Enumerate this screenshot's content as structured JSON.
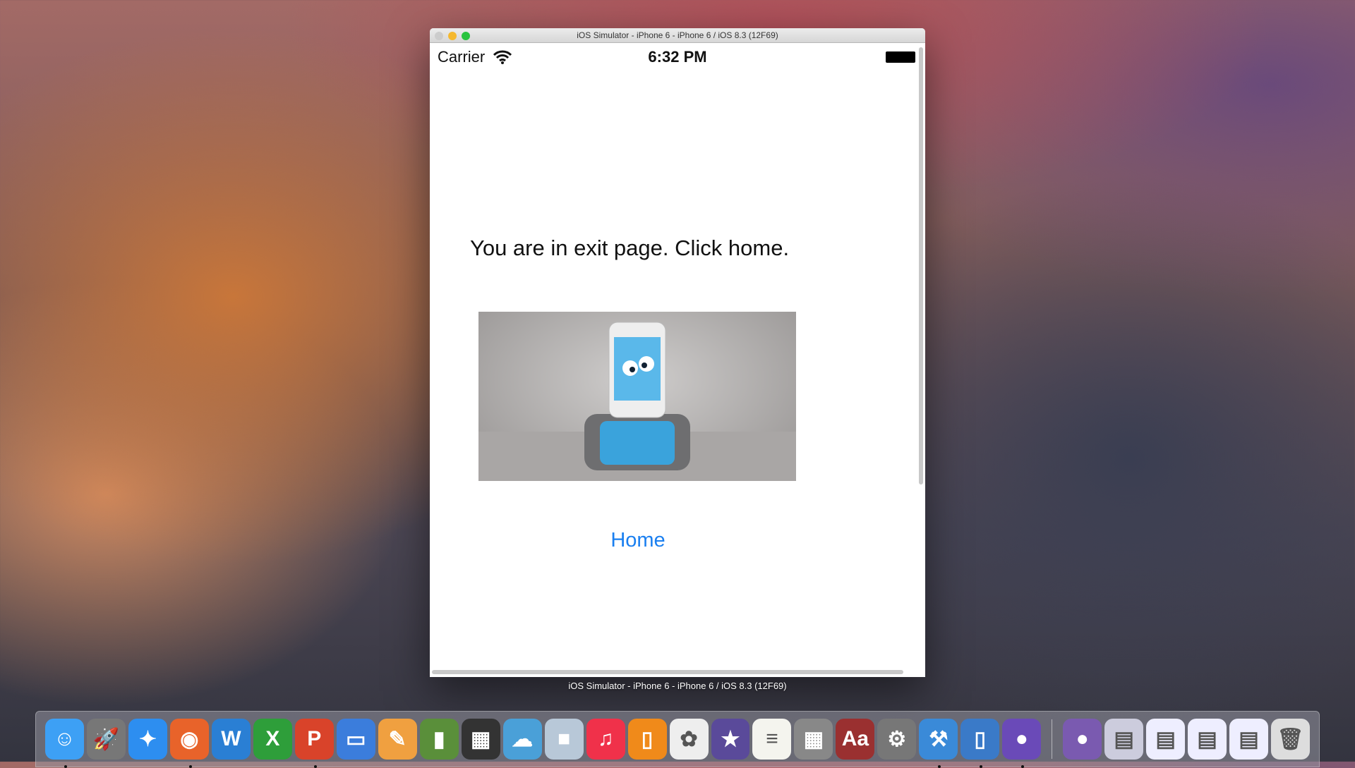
{
  "window": {
    "title": "iOS Simulator - iPhone 6 - iPhone 6 / iOS 8.3 (12F69)",
    "caption": "iOS Simulator - iPhone 6 - iPhone 6 / iOS 8.3 (12F69)"
  },
  "status_bar": {
    "carrier": "Carrier",
    "time": "6:32 PM"
  },
  "screen": {
    "message": "You are in exit page. Click home.",
    "home_link": "Home"
  },
  "dock": {
    "apps": [
      "Finder",
      "Launchpad",
      "Safari",
      "Firefox",
      "Word",
      "Excel",
      "PowerPoint",
      "Keynote",
      "Pages",
      "Numbers",
      "Photo Booth",
      "Cloud app",
      "VirtualBox",
      "iTunes",
      "iBooks",
      "Photos",
      "iMovie",
      "TextEdit",
      "Calculator",
      "Dictionary",
      "System Preferences",
      "Xcode",
      "iOS Simulator",
      "GitHub",
      "GitHub Folder",
      "Window 1",
      "Window 2",
      "Window 3",
      "Window 4",
      "Trash"
    ]
  }
}
